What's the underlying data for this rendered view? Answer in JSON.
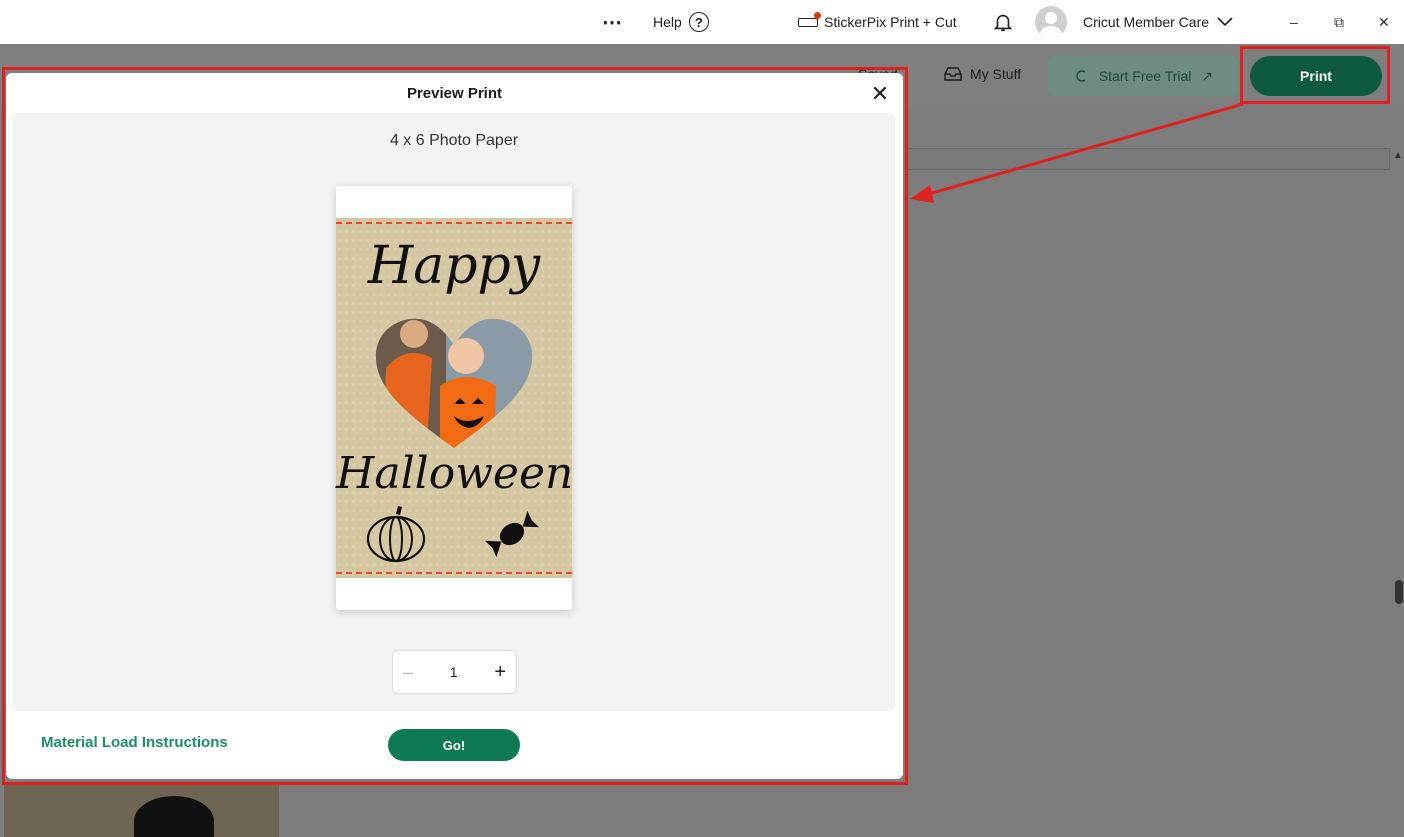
{
  "titlebar": {
    "more_icon": "⋯",
    "help_label": "Help",
    "help_icon": "?",
    "printer_label": "StickerPix Print + Cut",
    "account_label": "Cricut Member Care",
    "chevron": "⌄",
    "minimize": "–",
    "maximize": "⧉",
    "close": "✕"
  },
  "toolbar": {
    "saved_label": "Saved",
    "mystuff_label": "My Stuff",
    "trial_label": "Start Free Trial",
    "trial_arrow": "↗",
    "print_label": "Print"
  },
  "modal": {
    "title": "Preview Print",
    "close": "✕",
    "paper_label": "4 x 6 Photo Paper",
    "sticker": {
      "line1": "Happy",
      "line2": "Halloween"
    },
    "quantity": {
      "minus": "–",
      "value": "1",
      "plus": "+"
    },
    "material_link": "Material Load Instructions",
    "go_label": "Go!"
  },
  "colors": {
    "accent": "#0d7a55",
    "print_button": "#0d5a3f",
    "highlight": "#e0201f",
    "link": "#1a9068"
  }
}
